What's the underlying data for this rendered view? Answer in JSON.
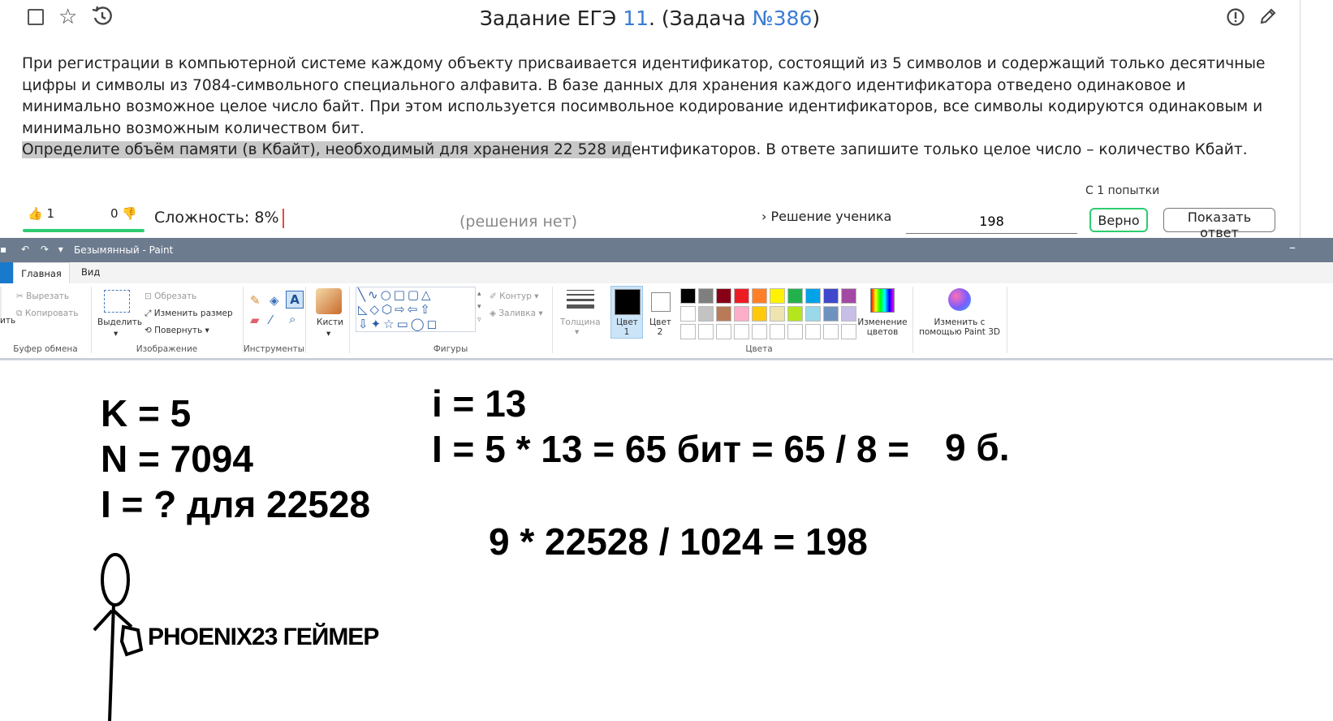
{
  "task": {
    "title_prefix": "Задание ЕГЭ ",
    "title_num": "11",
    "title_mid": ". (Задача ",
    "title_task": "№386",
    "title_end": ")",
    "para1": "При регистрации в компьютерной системе каждому объекту присваивается идентификатор, состоящий из 5 символов и содержащий только десятичные цифры и символы из 7084-символьного специального алфавита. В базе данных для хранения каждого идентификатора отведено одинаковое и минимально возможное целое число байт. При этом используется посимвольное кодирование идентификаторов, все символы кодируются одинаковым и минимально возможным количеством бит.",
    "para2_highlighted": "Определите объём памяти (в Кбайт), необходимый для хранения 22 528 ид",
    "para2_rest": "ентификаторов. В ответе запишите только целое число – количество Кбайт.",
    "attempts": "С 1 попытки",
    "likes": "1",
    "dislikes": "0",
    "difficulty": "Сложность: 8%",
    "no_solutions": "(решения нет)",
    "student_solution": "Решение ученика",
    "answer_value": "198",
    "correct_label": "Верно",
    "show_answer_label": "Показать ответ"
  },
  "paint": {
    "window_title": "Безымянный - Paint",
    "tabs": [
      "Главная",
      "Вид"
    ],
    "clipboard": {
      "cut": "Вырезать",
      "copy": "Копировать",
      "paste_partial": "ить",
      "group": "Буфер обмена"
    },
    "image": {
      "select": "Выделить",
      "crop": "Обрезать",
      "resize": "Изменить размер",
      "rotate": "Повернуть",
      "group": "Изображение"
    },
    "tools_group": "Инструменты",
    "brushes": "Кисти",
    "shapes": {
      "outline": "Контур",
      "fill": "Заливка",
      "group": "Фигуры"
    },
    "thickness": "Толщина",
    "color1": {
      "line1": "Цвет",
      "line2": "1"
    },
    "color2": {
      "line1": "Цвет",
      "line2": "2"
    },
    "edit_colors": {
      "line1": "Изменение",
      "line2": "цветов"
    },
    "paint3d": {
      "line1": "Изменить с",
      "line2": "помощью Paint 3D"
    },
    "colors_group": "Цвета",
    "palette_row1": [
      "#000000",
      "#7f7f7f",
      "#880015",
      "#ed1c24",
      "#ff7f27",
      "#fff200",
      "#22b14c",
      "#00a2e8",
      "#3f48cc",
      "#a349a4"
    ],
    "palette_row2": [
      "#ffffff",
      "#c3c3c3",
      "#b97a57",
      "#ffaec9",
      "#ffc90e",
      "#efe4b0",
      "#b5e61d",
      "#99d9ea",
      "#7092be",
      "#c8bfe7"
    ]
  },
  "drawing": {
    "line_k": "K = 5",
    "line_n": "N = 7094",
    "line_i_q": "I = ? для 22528",
    "line_i13": "i = 13",
    "line_calc": "I = 5 * 13 = 65 бит = 65 / 8 =",
    "line_9b": "9 б.",
    "line_result": "9 * 22528 / 1024 = 198",
    "signature": "PHOENIX23  ГЕЙМЕР"
  }
}
